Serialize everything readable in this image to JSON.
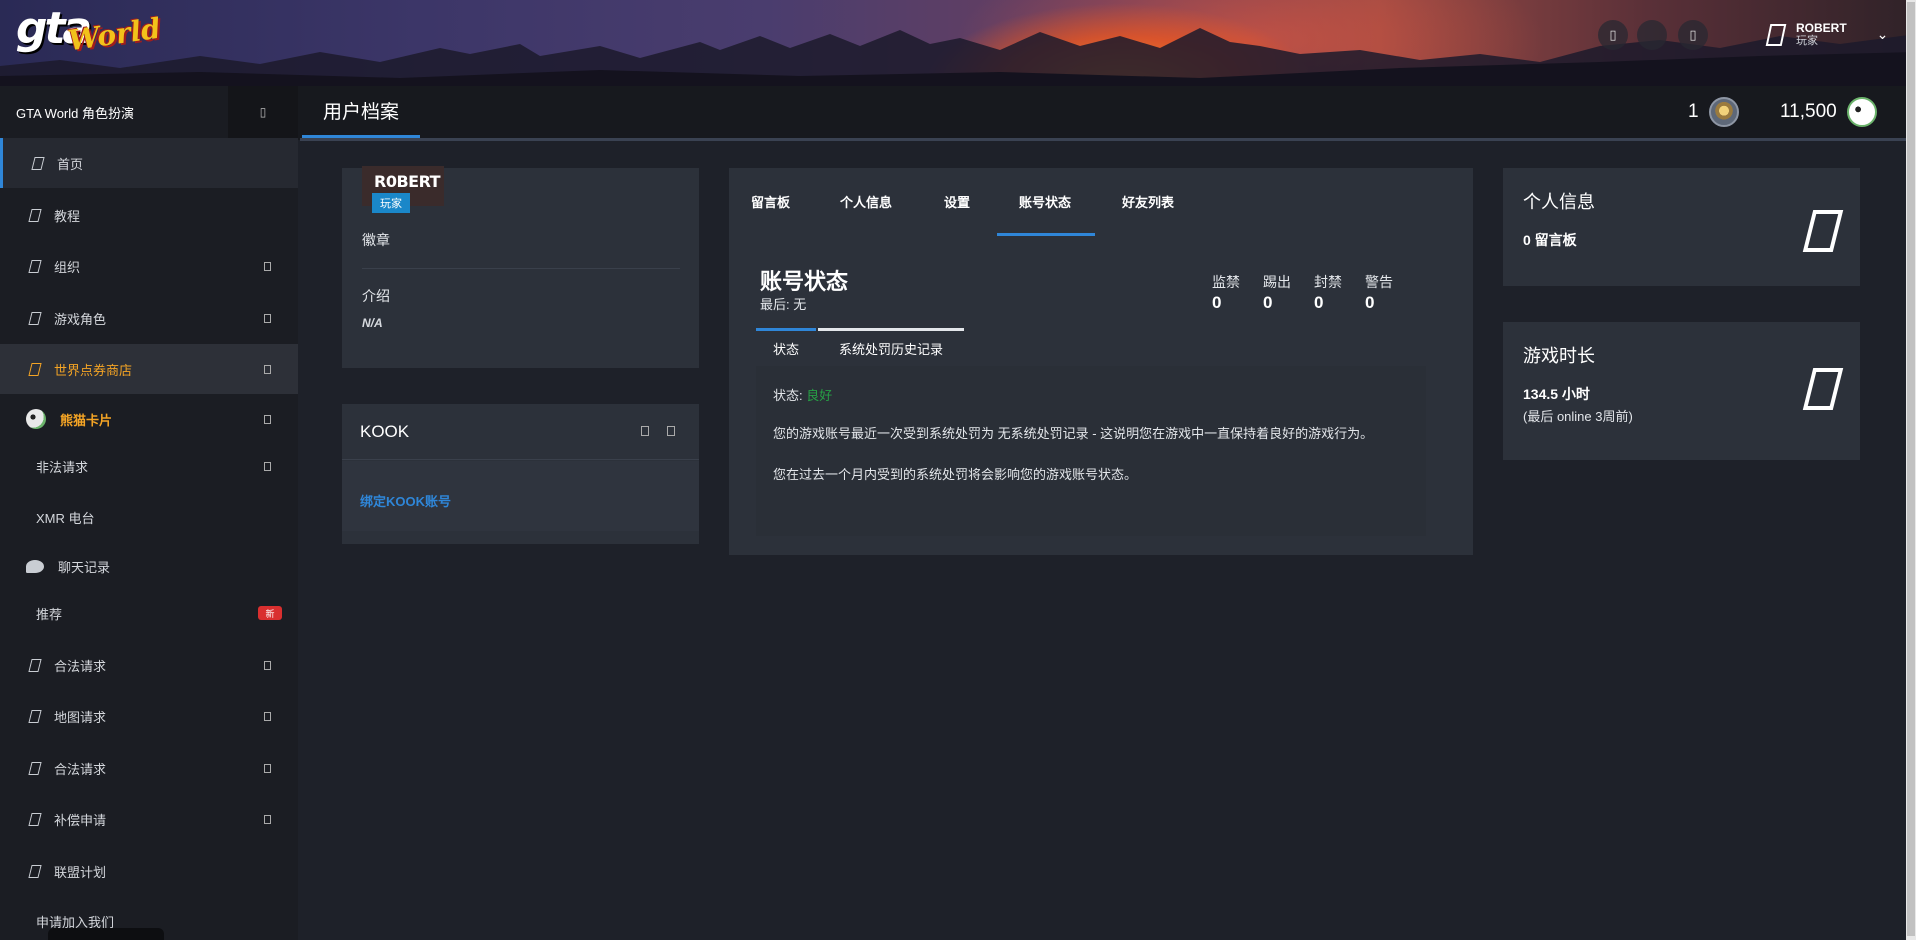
{
  "header": {
    "logo_gta": "gta",
    "logo_world": "World",
    "user": {
      "name": "ROBERT",
      "role": "玩家"
    },
    "icons": [
      "document-icon",
      "circle-icon",
      "document-icon"
    ],
    "brand_color": "#2f86d8"
  },
  "topbar": {
    "site_name": "GTA World 角色扮演",
    "page_title": "用户档案",
    "medals": "1",
    "points": "11,500"
  },
  "sidebar": {
    "items": [
      {
        "label": "首页"
      },
      {
        "label": "教程"
      },
      {
        "label": "组织"
      },
      {
        "label": "游戏角色"
      },
      {
        "label": "世界点券商店"
      },
      {
        "label": "熊猫卡片"
      },
      {
        "label": "非法请求"
      },
      {
        "label": "XMR 电台"
      },
      {
        "label": "聊天记录"
      },
      {
        "label": "推荐",
        "badge": "新"
      },
      {
        "label": "合法请求"
      },
      {
        "label": "地图请求"
      },
      {
        "label": "合法请求"
      },
      {
        "label": "补偿申请"
      },
      {
        "label": "联盟计划"
      },
      {
        "label": "申请加入我们"
      }
    ]
  },
  "profile": {
    "name": "R0BERT",
    "role": "玩家",
    "badges_label": "徽章",
    "intro_label": "介绍",
    "intro_value": "N/A"
  },
  "kook": {
    "title": "KOOK",
    "link": "绑定KOOK账号"
  },
  "main": {
    "tabs": [
      "留言板",
      "个人信息",
      "设置",
      "账号状态",
      "好友列表"
    ],
    "active_tab": "账号状态",
    "account_title": "账号状态",
    "last": "最后: 无",
    "counts": [
      {
        "label": "监禁",
        "value": "0"
      },
      {
        "label": "踢出",
        "value": "0"
      },
      {
        "label": "封禁",
        "value": "0"
      },
      {
        "label": "警告",
        "value": "0"
      }
    ],
    "subtabs": [
      "状态",
      "系统处罚历史记录"
    ],
    "status_label": "状态:",
    "status_value": "良好",
    "status_color": "#27a045",
    "paragraph1": "您的游戏账号最近一次受到系统处罚为 无系统处罚记录 - 这说明您在游戏中一直保持着良好的游戏行为。",
    "paragraph2": "您在过去一个月内受到的系统处罚将会影响您的游戏账号状态。"
  },
  "info_card": {
    "title": "个人信息",
    "value": "0 留言板"
  },
  "play_card": {
    "title": "游戏时长",
    "value": "134.5 小时",
    "sub": "(最后 online 3周前)"
  }
}
